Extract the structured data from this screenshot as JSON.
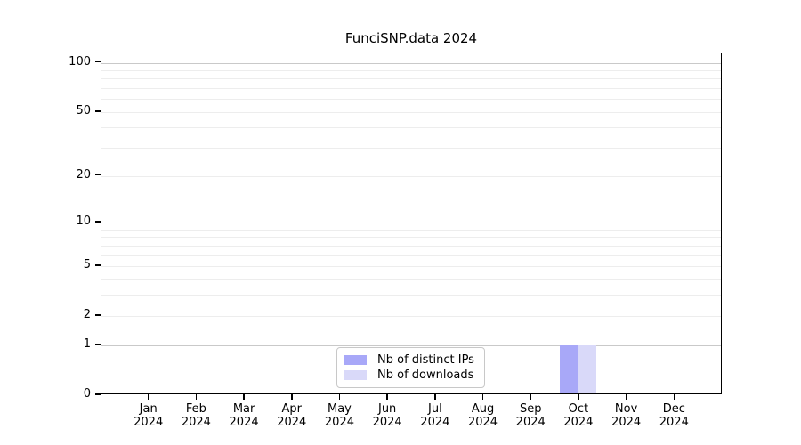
{
  "chart_data": {
    "type": "bar",
    "title": "FunciSNP.data 2024",
    "categories": [
      "Jan",
      "Feb",
      "Mar",
      "Apr",
      "May",
      "Jun",
      "Jul",
      "Aug",
      "Sep",
      "Oct",
      "Nov",
      "Dec"
    ],
    "year_label": "2024",
    "series": [
      {
        "name": "Nb of distinct IPs",
        "color": "#a8a8f8",
        "values": [
          0,
          0,
          0,
          0,
          0,
          0,
          0,
          0,
          0,
          1,
          0,
          0
        ]
      },
      {
        "name": "Nb of downloads",
        "color": "#d9d9f9",
        "values": [
          0,
          0,
          0,
          0,
          0,
          0,
          0,
          0,
          0,
          1,
          0,
          0
        ]
      }
    ],
    "xlabel": "",
    "ylabel": "",
    "yscale": "log10(1+y)",
    "ylim": [
      0,
      114
    ],
    "yticks": [
      0,
      1,
      2,
      5,
      10,
      20,
      50,
      100
    ],
    "major_gridlines": [
      1,
      10,
      100
    ],
    "minor_gridlines": [
      2,
      3,
      4,
      5,
      6,
      7,
      8,
      9,
      20,
      30,
      40,
      50,
      60,
      70,
      80,
      90
    ],
    "grid": true,
    "legend_position": "inside-bottom-center",
    "colors": {
      "background": "#ffffff",
      "axis": "#000000",
      "text": "#000000",
      "major_grid": "#c9c9c9",
      "minor_grid": "#ededed",
      "legend_border": "#c8c8c8"
    }
  }
}
